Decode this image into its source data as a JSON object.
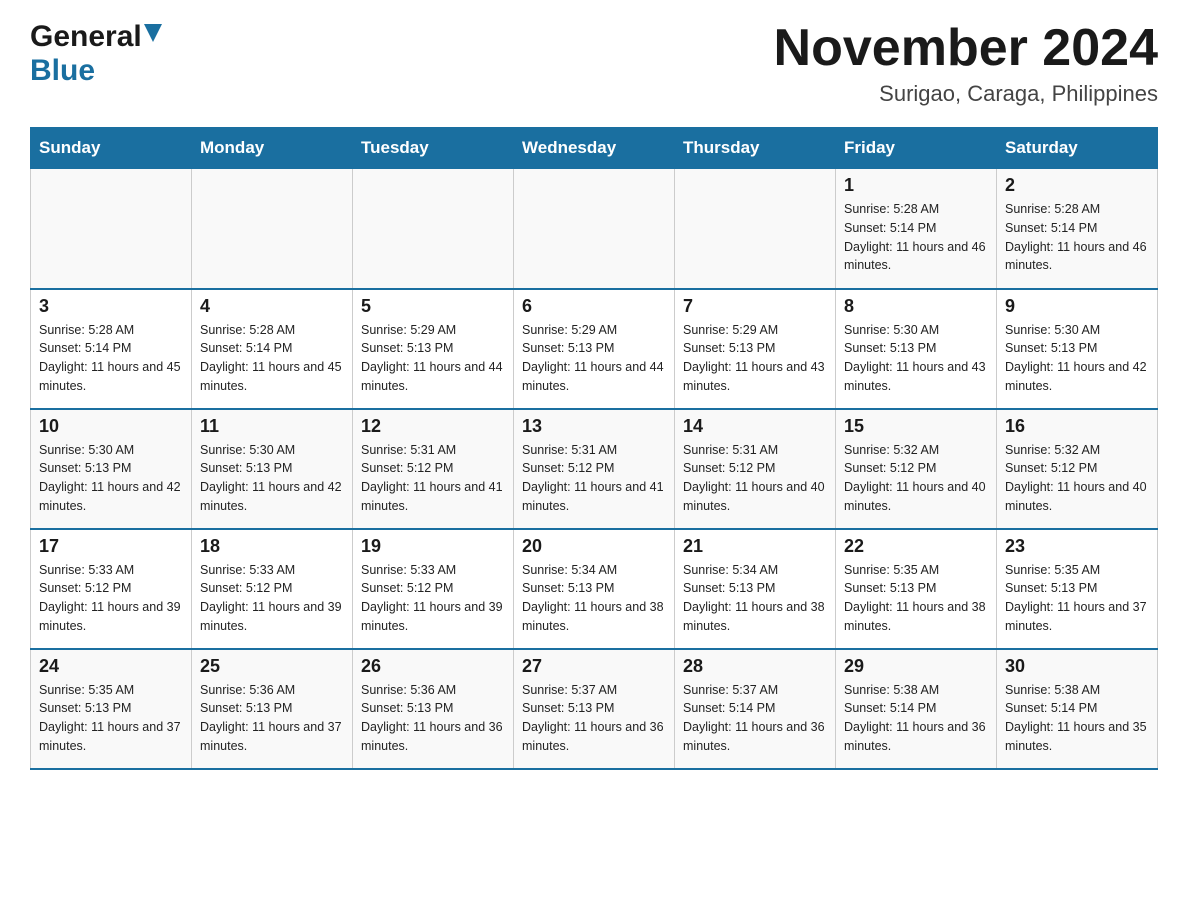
{
  "header": {
    "logo_general": "General",
    "logo_blue": "Blue",
    "month_year": "November 2024",
    "location": "Surigao, Caraga, Philippines"
  },
  "days_of_week": [
    "Sunday",
    "Monday",
    "Tuesday",
    "Wednesday",
    "Thursday",
    "Friday",
    "Saturday"
  ],
  "weeks": [
    [
      {
        "day": "",
        "info": ""
      },
      {
        "day": "",
        "info": ""
      },
      {
        "day": "",
        "info": ""
      },
      {
        "day": "",
        "info": ""
      },
      {
        "day": "",
        "info": ""
      },
      {
        "day": "1",
        "info": "Sunrise: 5:28 AM\nSunset: 5:14 PM\nDaylight: 11 hours and 46 minutes."
      },
      {
        "day": "2",
        "info": "Sunrise: 5:28 AM\nSunset: 5:14 PM\nDaylight: 11 hours and 46 minutes."
      }
    ],
    [
      {
        "day": "3",
        "info": "Sunrise: 5:28 AM\nSunset: 5:14 PM\nDaylight: 11 hours and 45 minutes."
      },
      {
        "day": "4",
        "info": "Sunrise: 5:28 AM\nSunset: 5:14 PM\nDaylight: 11 hours and 45 minutes."
      },
      {
        "day": "5",
        "info": "Sunrise: 5:29 AM\nSunset: 5:13 PM\nDaylight: 11 hours and 44 minutes."
      },
      {
        "day": "6",
        "info": "Sunrise: 5:29 AM\nSunset: 5:13 PM\nDaylight: 11 hours and 44 minutes."
      },
      {
        "day": "7",
        "info": "Sunrise: 5:29 AM\nSunset: 5:13 PM\nDaylight: 11 hours and 43 minutes."
      },
      {
        "day": "8",
        "info": "Sunrise: 5:30 AM\nSunset: 5:13 PM\nDaylight: 11 hours and 43 minutes."
      },
      {
        "day": "9",
        "info": "Sunrise: 5:30 AM\nSunset: 5:13 PM\nDaylight: 11 hours and 42 minutes."
      }
    ],
    [
      {
        "day": "10",
        "info": "Sunrise: 5:30 AM\nSunset: 5:13 PM\nDaylight: 11 hours and 42 minutes."
      },
      {
        "day": "11",
        "info": "Sunrise: 5:30 AM\nSunset: 5:13 PM\nDaylight: 11 hours and 42 minutes."
      },
      {
        "day": "12",
        "info": "Sunrise: 5:31 AM\nSunset: 5:12 PM\nDaylight: 11 hours and 41 minutes."
      },
      {
        "day": "13",
        "info": "Sunrise: 5:31 AM\nSunset: 5:12 PM\nDaylight: 11 hours and 41 minutes."
      },
      {
        "day": "14",
        "info": "Sunrise: 5:31 AM\nSunset: 5:12 PM\nDaylight: 11 hours and 40 minutes."
      },
      {
        "day": "15",
        "info": "Sunrise: 5:32 AM\nSunset: 5:12 PM\nDaylight: 11 hours and 40 minutes."
      },
      {
        "day": "16",
        "info": "Sunrise: 5:32 AM\nSunset: 5:12 PM\nDaylight: 11 hours and 40 minutes."
      }
    ],
    [
      {
        "day": "17",
        "info": "Sunrise: 5:33 AM\nSunset: 5:12 PM\nDaylight: 11 hours and 39 minutes."
      },
      {
        "day": "18",
        "info": "Sunrise: 5:33 AM\nSunset: 5:12 PM\nDaylight: 11 hours and 39 minutes."
      },
      {
        "day": "19",
        "info": "Sunrise: 5:33 AM\nSunset: 5:12 PM\nDaylight: 11 hours and 39 minutes."
      },
      {
        "day": "20",
        "info": "Sunrise: 5:34 AM\nSunset: 5:13 PM\nDaylight: 11 hours and 38 minutes."
      },
      {
        "day": "21",
        "info": "Sunrise: 5:34 AM\nSunset: 5:13 PM\nDaylight: 11 hours and 38 minutes."
      },
      {
        "day": "22",
        "info": "Sunrise: 5:35 AM\nSunset: 5:13 PM\nDaylight: 11 hours and 38 minutes."
      },
      {
        "day": "23",
        "info": "Sunrise: 5:35 AM\nSunset: 5:13 PM\nDaylight: 11 hours and 37 minutes."
      }
    ],
    [
      {
        "day": "24",
        "info": "Sunrise: 5:35 AM\nSunset: 5:13 PM\nDaylight: 11 hours and 37 minutes."
      },
      {
        "day": "25",
        "info": "Sunrise: 5:36 AM\nSunset: 5:13 PM\nDaylight: 11 hours and 37 minutes."
      },
      {
        "day": "26",
        "info": "Sunrise: 5:36 AM\nSunset: 5:13 PM\nDaylight: 11 hours and 36 minutes."
      },
      {
        "day": "27",
        "info": "Sunrise: 5:37 AM\nSunset: 5:13 PM\nDaylight: 11 hours and 36 minutes."
      },
      {
        "day": "28",
        "info": "Sunrise: 5:37 AM\nSunset: 5:14 PM\nDaylight: 11 hours and 36 minutes."
      },
      {
        "day": "29",
        "info": "Sunrise: 5:38 AM\nSunset: 5:14 PM\nDaylight: 11 hours and 36 minutes."
      },
      {
        "day": "30",
        "info": "Sunrise: 5:38 AM\nSunset: 5:14 PM\nDaylight: 11 hours and 35 minutes."
      }
    ]
  ]
}
